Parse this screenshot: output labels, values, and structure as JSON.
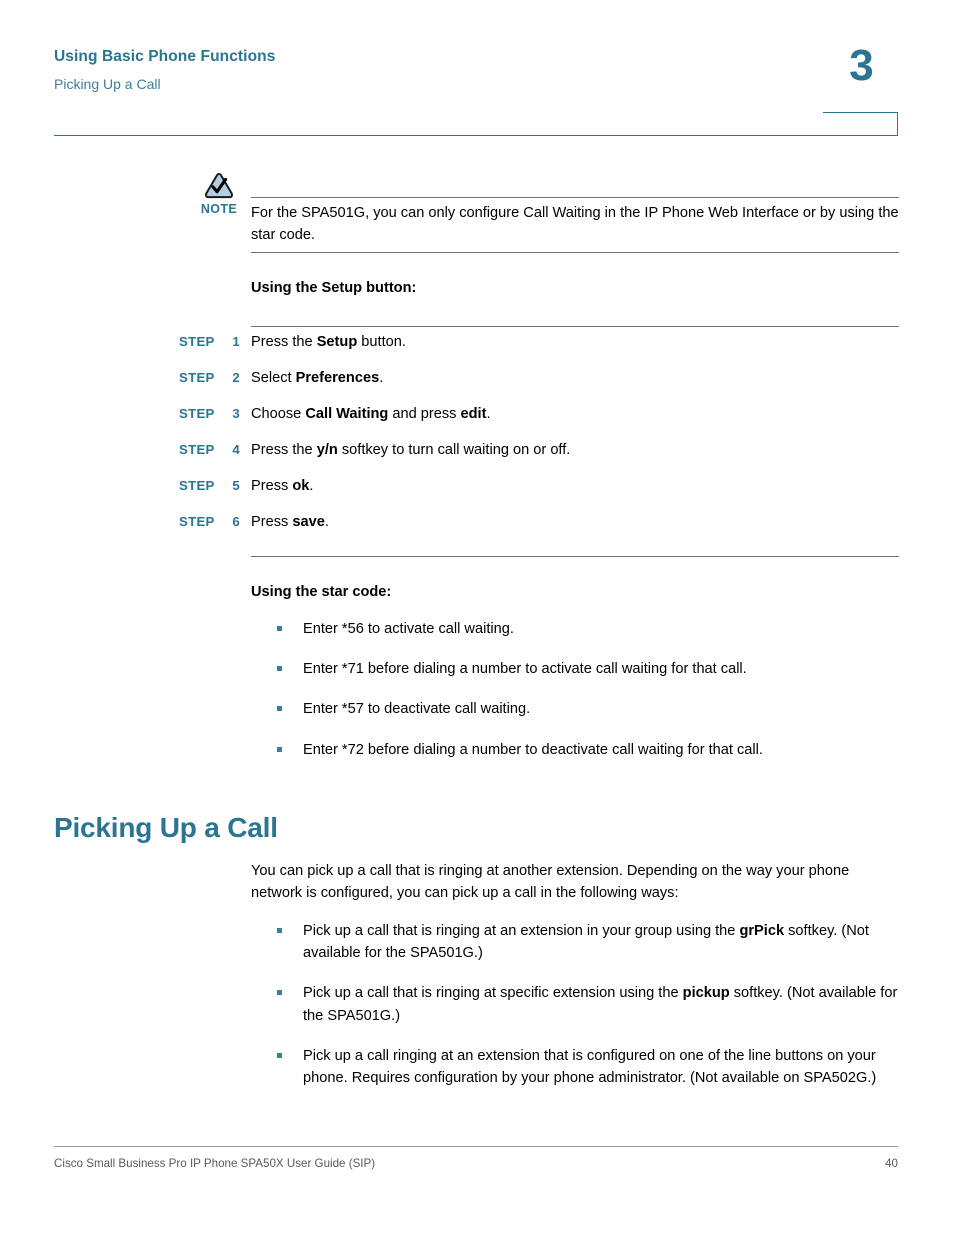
{
  "header": {
    "title": "Using Basic Phone Functions",
    "subtitle": "Picking Up a Call",
    "chapter_number": "3",
    "accent_color": "#2a7592"
  },
  "note": {
    "icon": "note-triangle-check-icon",
    "label": "NOTE",
    "text": "For the SPA501G, you can only configure Call Waiting in the IP Phone Web Interface or by using the star code."
  },
  "setup_section": {
    "heading": "Using the Setup button:",
    "step_label": "STEP",
    "steps": [
      {
        "number": "1",
        "text_before": "Press the ",
        "bold": "Setup",
        "text_after": " button."
      },
      {
        "number": "2",
        "text_before": "Select ",
        "bold": "Preferences",
        "text_after": "."
      },
      {
        "number": "3",
        "text_before": "Choose ",
        "bold": "Call Waiting",
        "text_mid": " and press ",
        "bold2": "edit",
        "text_after": "."
      },
      {
        "number": "4",
        "text_before": "Press the ",
        "bold": "y/n",
        "text_after": " softkey to turn call waiting on or off."
      },
      {
        "number": "5",
        "text_before": "Press ",
        "bold": "ok",
        "text_after": "."
      },
      {
        "number": "6",
        "text_before": "Press ",
        "bold": "save",
        "text_after": "."
      }
    ]
  },
  "starcode_section": {
    "heading": "Using the star code:",
    "bullets": [
      "Enter *56 to activate call waiting.",
      "Enter *71 before dialing a number to activate call waiting for that call.",
      "Enter *57 to deactivate call waiting.",
      "Enter *72 before dialing a number to deactivate call waiting for that call."
    ]
  },
  "section": {
    "heading": "Picking Up a Call",
    "paragraph": "You can pick up a call that is ringing at another extension. Depending on the way your phone network is configured, you can pick up a call in the following ways:",
    "bullets": [
      {
        "before": "Pick up a call that is ringing at an extension in your group using the ",
        "bold": "grPick",
        "after": " softkey. (Not available for the SPA501G.)"
      },
      {
        "before": "Pick up a call that is ringing at specific extension using the ",
        "bold": "pickup",
        "after": " softkey. (Not available for the SPA501G.)"
      },
      {
        "before": "Pick up a call ringing at an extension that is configured on one of the line buttons on your phone. Requires configuration by your phone administrator. (Not available on SPA502G.)",
        "bold": "",
        "after": ""
      }
    ]
  },
  "footer": {
    "left": "Cisco Small Business Pro IP Phone SPA50X User Guide (SIP)",
    "page_number": "40"
  }
}
